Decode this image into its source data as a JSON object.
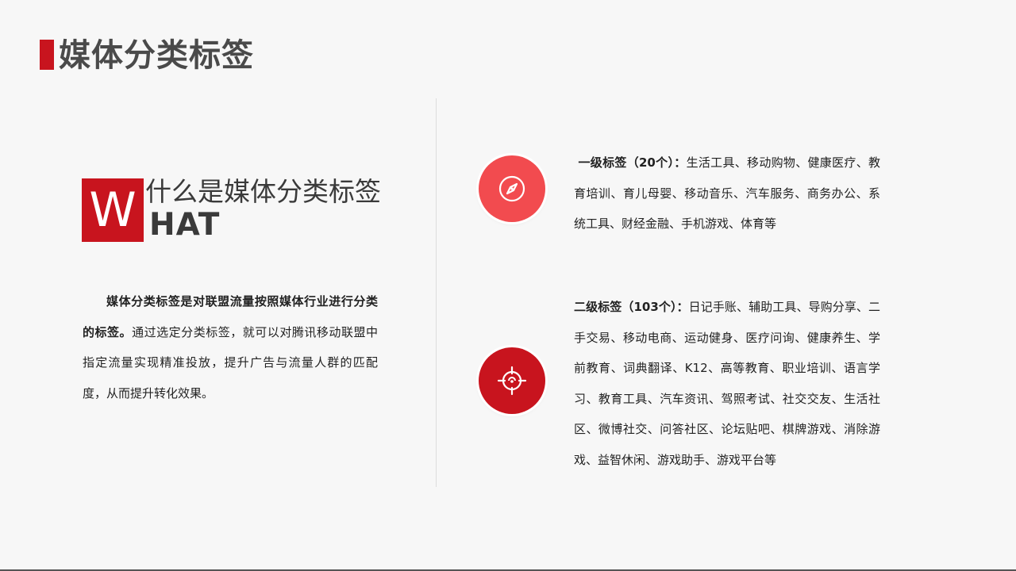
{
  "page": {
    "title": "媒体分类标签",
    "accent_color": "#c8141e",
    "accent_light": "#f24b4f"
  },
  "what": {
    "w_letter": "W",
    "cn_title": "什么是媒体分类标签",
    "en_rest": "HAT"
  },
  "description": {
    "bold_part": "媒体分类标签是对联盟流量按照媒体行业进行分类的标签。",
    "normal_part": "通过选定分类标签，就可以对腾讯移动联盟中指定流量实现精准投放，提升广告与流量人群的匹配度，从而提升转化效果。"
  },
  "level1": {
    "icon": "compass-icon",
    "heading": " 一级标签（20个）：",
    "items": "生活工具、移动购物、健康医疗、教育培训、育儿母婴、移动音乐、汽车服务、商务办公、系统工具、财经金融、手机游戏、体育等"
  },
  "level2": {
    "icon": "target-icon",
    "heading": "二级标签（103个）：",
    "items": "日记手账、辅助工具、导购分享、二手交易、移动电商、运动健身、医疗问询、健康养生、学前教育、词典翻译、K12、高等教育、职业培训、语言学习、教育工具、汽车资讯、驾照考试、社交交友、生活社区、微博社交、问答社区、论坛贴吧、棋牌游戏、消除游戏、益智休闲、游戏助手、游戏平台等"
  }
}
